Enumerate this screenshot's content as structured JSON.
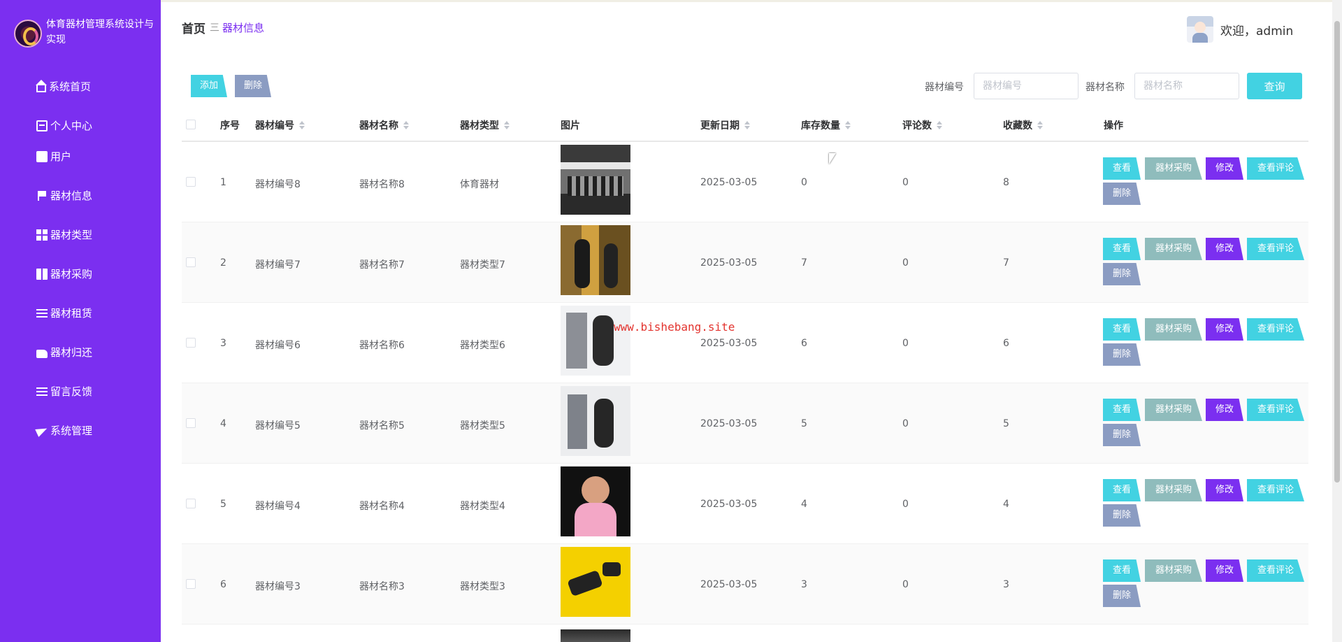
{
  "app": {
    "title": "体育器材管理系统设计与实现"
  },
  "sidebar": {
    "items": [
      {
        "label": "系统首页",
        "icon": "home-icon"
      },
      {
        "label": "个人中心",
        "icon": "user-card-icon"
      },
      {
        "label": "用户",
        "icon": "chart-icon"
      },
      {
        "label": "器材信息",
        "icon": "flag-icon"
      },
      {
        "label": "器材类型",
        "icon": "grid-icon"
      },
      {
        "label": "器材采购",
        "icon": "book-icon"
      },
      {
        "label": "器材租赁",
        "icon": "list-icon"
      },
      {
        "label": "器材归还",
        "icon": "thumb-icon"
      },
      {
        "label": "留言反馈",
        "icon": "list-icon"
      },
      {
        "label": "系统管理",
        "icon": "send-icon"
      }
    ]
  },
  "header": {
    "breadcrumb_home": "首页",
    "breadcrumb_sep": "三",
    "breadcrumb_current": "器材信息",
    "welcome": "欢迎，admin"
  },
  "toolbar": {
    "add_label": "添加",
    "delete_label": "删除",
    "search": [
      {
        "label": "器材编号",
        "placeholder": "器材编号"
      },
      {
        "label": "器材名称",
        "placeholder": "器材名称"
      }
    ],
    "query_label": "查询"
  },
  "table": {
    "columns": [
      "序号",
      "器材编号",
      "器材名称",
      "器材类型",
      "图片",
      "更新日期",
      "库存数量",
      "评论数",
      "收藏数",
      "操作"
    ],
    "rows": [
      {
        "index": "1",
        "code": "器材编号8",
        "name": "器材名称8",
        "type": "体育器材",
        "date": "2025-03-05",
        "stock": "0",
        "comments": "0",
        "favorites": "8"
      },
      {
        "index": "2",
        "code": "器材编号7",
        "name": "器材名称7",
        "type": "器材类型7",
        "date": "2025-03-05",
        "stock": "7",
        "comments": "0",
        "favorites": "7"
      },
      {
        "index": "3",
        "code": "器材编号6",
        "name": "器材名称6",
        "type": "器材类型6",
        "date": "2025-03-05",
        "stock": "6",
        "comments": "0",
        "favorites": "6"
      },
      {
        "index": "4",
        "code": "器材编号5",
        "name": "器材名称5",
        "type": "器材类型5",
        "date": "2025-03-05",
        "stock": "5",
        "comments": "0",
        "favorites": "5"
      },
      {
        "index": "5",
        "code": "器材编号4",
        "name": "器材名称4",
        "type": "器材类型4",
        "date": "2025-03-05",
        "stock": "4",
        "comments": "0",
        "favorites": "4"
      },
      {
        "index": "6",
        "code": "器材编号3",
        "name": "器材名称3",
        "type": "器材类型3",
        "date": "2025-03-05",
        "stock": "3",
        "comments": "0",
        "favorites": "3"
      }
    ],
    "actions": {
      "view": "查看",
      "purchase": "器材采购",
      "edit": "修改",
      "reviews": "查看评论",
      "delete": "删除"
    }
  },
  "watermark": "www.bishebang.site",
  "colors": {
    "sidebar": "#7b2ff0",
    "accent_cyan": "#42d2e2",
    "muted_blue": "#8b9cc2",
    "teal_gray": "#8fbcbc"
  }
}
